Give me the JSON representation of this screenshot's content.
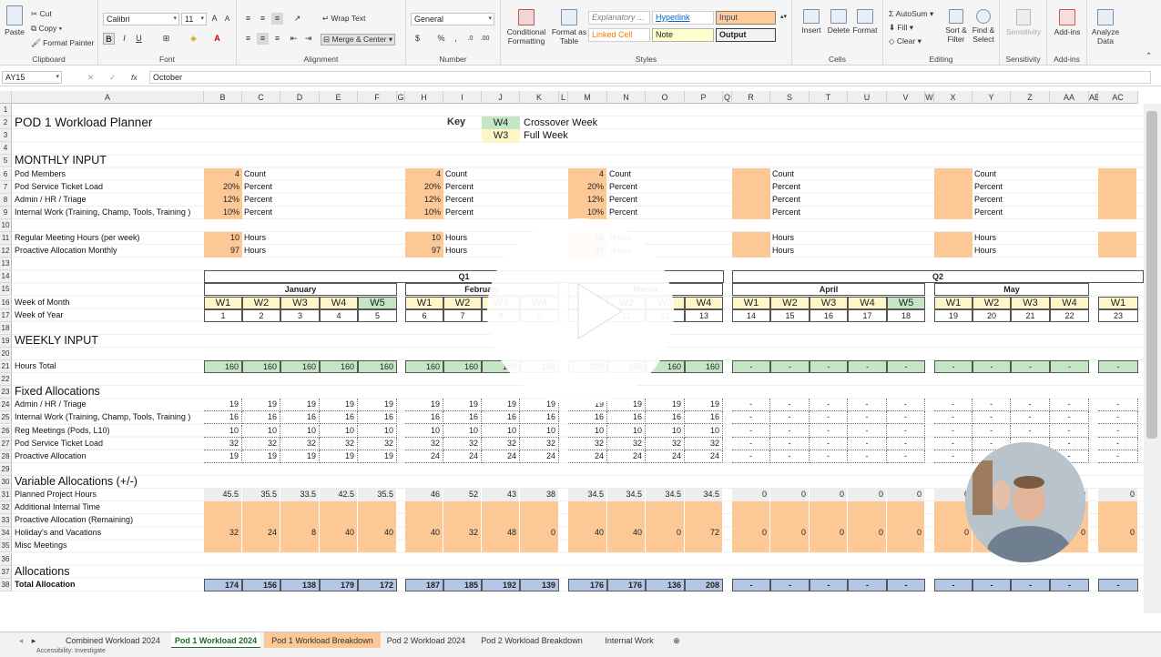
{
  "ribbon": {
    "clipboard": {
      "paste": "Paste",
      "cut": "Cut",
      "copy": "Copy",
      "format_painter": "Format Painter",
      "label": "Clipboard"
    },
    "font": {
      "name": "Calibri",
      "size": "11",
      "label": "Font"
    },
    "alignment": {
      "wrap": "Wrap Text",
      "merge": "Merge & Center",
      "label": "Alignment"
    },
    "number": {
      "format": "General",
      "label": "Number"
    },
    "styles": {
      "conditional": "Conditional Formatting",
      "format_table": "Format as Table",
      "explanatory": "Explanatory ...",
      "hyperlink": "Hyperlink",
      "input": "Input",
      "linked": "Linked Cell",
      "note": "Note",
      "output": "Output",
      "label": "Styles"
    },
    "cells": {
      "insert": "Insert",
      "delete": "Delete",
      "format": "Format",
      "label": "Cells"
    },
    "editing": {
      "autosum": "AutoSum",
      "fill": "Fill",
      "clear": "Clear",
      "sort": "Sort & Filter",
      "find": "Find & Select",
      "label": "Editing"
    },
    "sensitivity": {
      "btn": "Sensitivity",
      "label": "Sensitivity"
    },
    "addins": {
      "btn": "Add-ins",
      "label": "Add-ins"
    },
    "analyze": {
      "btn": "Analyze Data"
    }
  },
  "formula_bar": {
    "name_box": "AY15",
    "fx": "fx",
    "content": "October"
  },
  "columns": [
    "A",
    "B",
    "C",
    "D",
    "E",
    "F",
    "G",
    "H",
    "I",
    "J",
    "K",
    "L",
    "M",
    "N",
    "O",
    "P",
    "Q",
    "R",
    "S",
    "T",
    "U",
    "V",
    "W",
    "X",
    "Y",
    "Z",
    "AA",
    "AB",
    "AC"
  ],
  "sheet": {
    "title": "POD 1 Workload Planner",
    "key_label": "Key",
    "key": [
      {
        "code": "W4",
        "text": "Crossover Week"
      },
      {
        "code": "W3",
        "text": "Full Week"
      }
    ],
    "monthly_input": "MONTHLY INPUT",
    "monthly_rows": [
      {
        "label": "Pod Members",
        "vals": [
          "4",
          "4",
          "4",
          "",
          ""
        ],
        "unit": "Count"
      },
      {
        "label": "Pod Service Ticket Load",
        "vals": [
          "20%",
          "20%",
          "20%",
          "",
          ""
        ],
        "unit": "Percent"
      },
      {
        "label": "Admin / HR / Triage",
        "vals": [
          "12%",
          "12%",
          "12%",
          "",
          ""
        ],
        "unit": "Percent"
      },
      {
        "label": "Internal Work (Training, Champ, Tools,  Training )",
        "vals": [
          "10%",
          "10%",
          "10%",
          "",
          ""
        ],
        "unit": "Percent"
      },
      {
        "label": "Regular Meeting Hours (per week)",
        "vals": [
          "10",
          "10",
          "10",
          "",
          ""
        ],
        "unit": "Hours"
      },
      {
        "label": "Proactive Allocation Monthly",
        "vals": [
          "97",
          "97",
          "97",
          "",
          ""
        ],
        "unit": "Hours"
      }
    ],
    "quarters": [
      "Q1",
      "Q2"
    ],
    "months": [
      "January",
      "February",
      "March",
      "April",
      "May"
    ],
    "week_of_month_label": "Week of Month",
    "week_of_year_label": "Week of Year",
    "weeks": [
      "W1",
      "W2",
      "W3",
      "W4",
      "W5",
      "W1",
      "W2",
      "W3",
      "W4",
      "W1",
      "W2",
      "W3",
      "W4",
      "W1",
      "W2",
      "W3",
      "W4",
      "W5",
      "W1",
      "W2",
      "W3",
      "W4",
      "W1"
    ],
    "week_numbers": [
      "1",
      "2",
      "3",
      "4",
      "5",
      "6",
      "7",
      "8",
      "9",
      "10",
      "11",
      "12",
      "13",
      "14",
      "15",
      "16",
      "17",
      "18",
      "19",
      "20",
      "21",
      "22",
      "23"
    ],
    "weekly_input": "WEEKLY INPUT",
    "hours_total_label": "Hours Total",
    "hours_total": [
      "160",
      "160",
      "160",
      "160",
      "160",
      "160",
      "160",
      "160",
      "160",
      "160",
      "160",
      "160",
      "160",
      "-",
      "-",
      "-",
      "-",
      "-",
      "-",
      "-",
      "-",
      "-",
      "-"
    ],
    "fixed_alloc": "Fixed Allocations",
    "fixed_rows": [
      {
        "label": "Admin / HR / Triage",
        "vals": [
          "19",
          "19",
          "19",
          "19",
          "19",
          "19",
          "19",
          "19",
          "19",
          "19",
          "19",
          "19",
          "19",
          "-",
          "-",
          "-",
          "-",
          "-",
          "-",
          "-",
          "-",
          "-",
          "-"
        ]
      },
      {
        "label": "Internal Work (Training, Champ, Tools,  Training )",
        "vals": [
          "16",
          "16",
          "16",
          "16",
          "16",
          "16",
          "16",
          "16",
          "16",
          "16",
          "16",
          "16",
          "16",
          "-",
          "-",
          "-",
          "-",
          "-",
          "-",
          "-",
          "-",
          "-",
          "-"
        ]
      },
      {
        "label": "Reg Meetings (Pods,  L10)",
        "vals": [
          "10",
          "10",
          "10",
          "10",
          "10",
          "10",
          "10",
          "10",
          "10",
          "10",
          "10",
          "10",
          "10",
          "-",
          "-",
          "-",
          "-",
          "-",
          "-",
          "-",
          "-",
          "-",
          "-"
        ]
      },
      {
        "label": "Pod Service Ticket Load",
        "vals": [
          "32",
          "32",
          "32",
          "32",
          "32",
          "32",
          "32",
          "32",
          "32",
          "32",
          "32",
          "32",
          "32",
          "-",
          "-",
          "-",
          "-",
          "-",
          "-",
          "-",
          "-",
          "-",
          "-"
        ]
      },
      {
        "label": "Proactive Allocation",
        "vals": [
          "19",
          "19",
          "19",
          "19",
          "19",
          "24",
          "24",
          "24",
          "24",
          "24",
          "24",
          "24",
          "24",
          "-",
          "-",
          "-",
          "-",
          "-",
          "-",
          "-",
          "-",
          "-",
          "-"
        ]
      }
    ],
    "variable_alloc": "Variable Allocations (+/-)",
    "variable_rows": [
      {
        "label": "Planned Project Hours",
        "vals": [
          "45.5",
          "35.5",
          "33.5",
          "42.5",
          "35.5",
          "46",
          "52",
          "43",
          "38",
          "34.5",
          "34.5",
          "34.5",
          "34.5",
          "0",
          "0",
          "0",
          "0",
          "0",
          "0",
          "0",
          "0",
          "0",
          "0"
        ]
      },
      {
        "label": "Additional Internal Time",
        "vals": [
          "",
          "",
          "",
          "",
          "",
          "",
          "",
          "",
          "",
          "",
          "",
          "",
          "",
          "",
          "",
          "",
          "",
          "",
          "",
          "",
          "",
          "",
          ""
        ]
      },
      {
        "label": "Proactive Allocation (Remaining)",
        "vals": [
          "",
          "",
          "",
          "",
          "",
          "",
          "",
          "",
          "",
          "",
          "",
          "",
          "",
          "",
          "",
          "",
          "",
          "",
          "",
          "",
          "",
          "",
          ""
        ]
      },
      {
        "label": "Holiday's and Vacations",
        "vals": [
          "32",
          "24",
          "8",
          "40",
          "40",
          "40",
          "32",
          "48",
          "0",
          "40",
          "40",
          "0",
          "72",
          "0",
          "0",
          "0",
          "0",
          "0",
          "0",
          "0",
          "0",
          "0",
          "0"
        ]
      },
      {
        "label": "Misc Meetings",
        "vals": [
          "",
          "",
          "",
          "",
          "",
          "",
          "",
          "",
          "",
          "",
          "",
          "",
          "",
          "",
          "",
          "",
          "",
          "",
          "",
          "",
          "",
          "",
          ""
        ]
      }
    ],
    "allocations": "Allocations",
    "total_label": "Total Allocation",
    "total": [
      "174",
      "156",
      "138",
      "179",
      "172",
      "187",
      "185",
      "192",
      "139",
      "176",
      "176",
      "136",
      "208",
      "-",
      "-",
      "-",
      "-",
      "-",
      "-",
      "-",
      "-",
      "-",
      "-"
    ]
  },
  "tabs": [
    "Combined Workload 2024",
    "Pod 1 Workload 2024",
    "Pod 1 Workload Breakdown",
    "Pod 2 Workload 2024",
    "Pod 2 Workload Breakdown",
    "Internal Work"
  ],
  "status": {
    "text": "Accessibility: Investigate"
  }
}
